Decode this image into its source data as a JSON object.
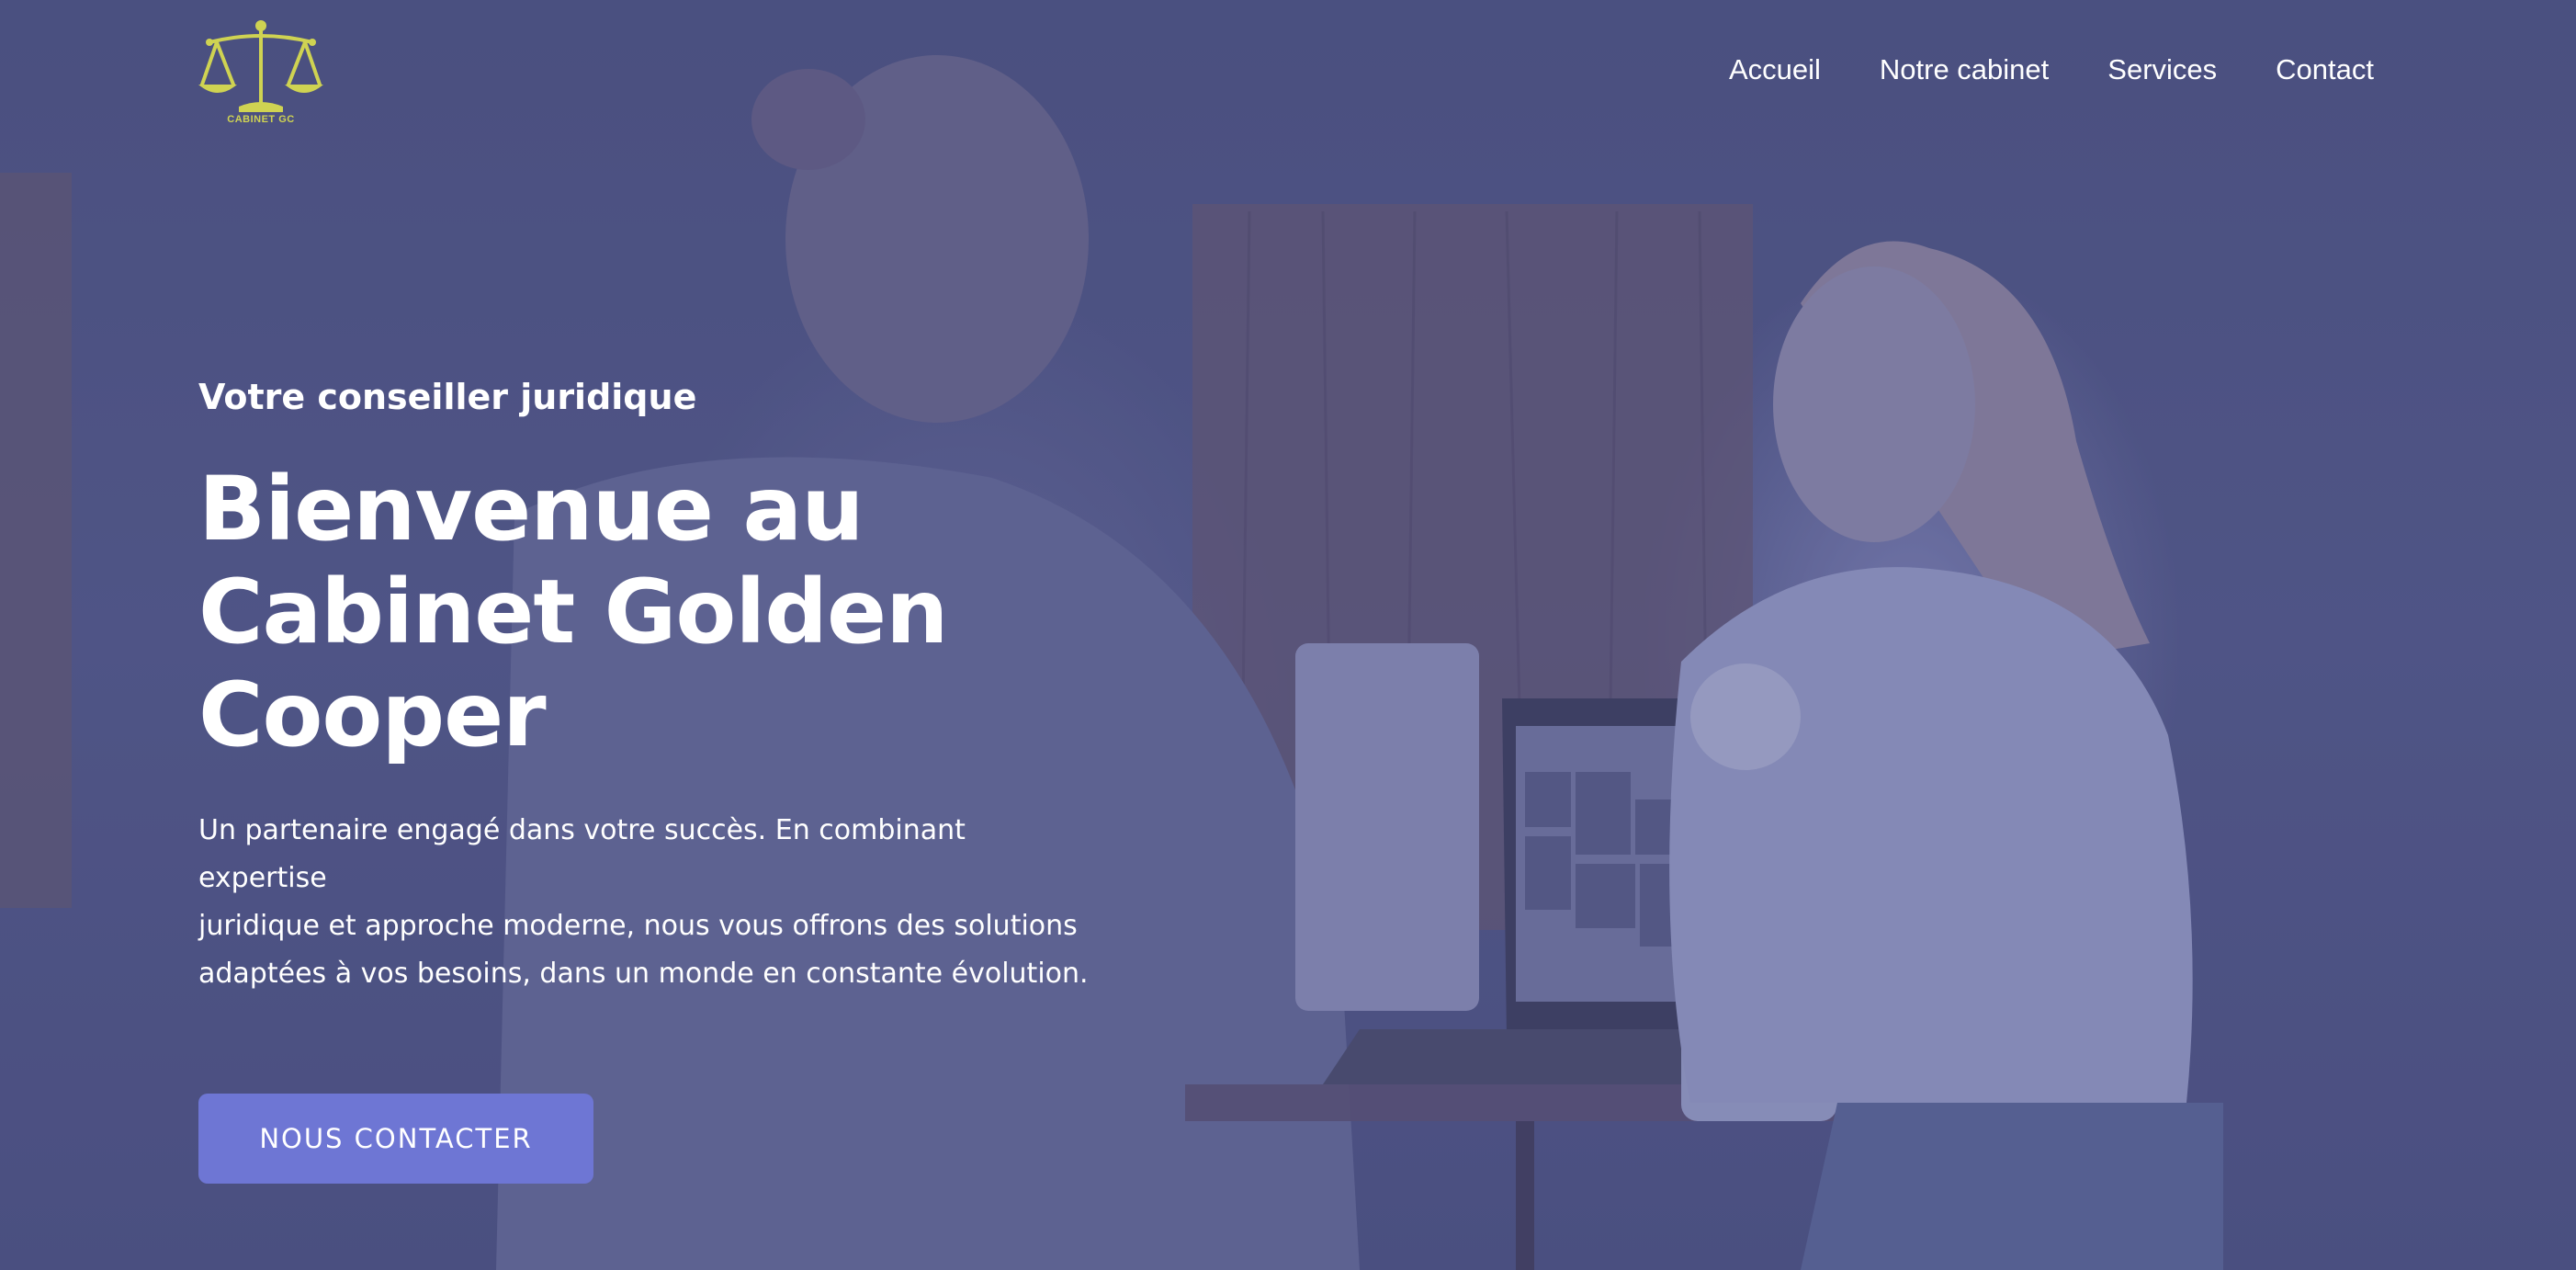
{
  "brand": {
    "logo_text": "CABINET GC",
    "logo_color": "#cfd352"
  },
  "nav": {
    "items": [
      {
        "label": "Accueil"
      },
      {
        "label": "Notre cabinet"
      },
      {
        "label": "Services"
      },
      {
        "label": "Contact"
      }
    ]
  },
  "hero": {
    "eyebrow": "Votre conseiller juridique",
    "title_lines": [
      "Bienvenue au",
      "Cabinet Golden",
      "Cooper"
    ],
    "description_lines": [
      "Un partenaire engagé dans votre succès. En combinant expertise",
      "juridique et approche moderne, nous vous offrons des solutions",
      "adaptées à vos besoins, dans un monde en constante évolution."
    ],
    "cta_label": "NOUS CONTACTER"
  },
  "colors": {
    "overlay": "#4b4f7c",
    "cta": "#6e76d4",
    "text": "#ffffff"
  }
}
